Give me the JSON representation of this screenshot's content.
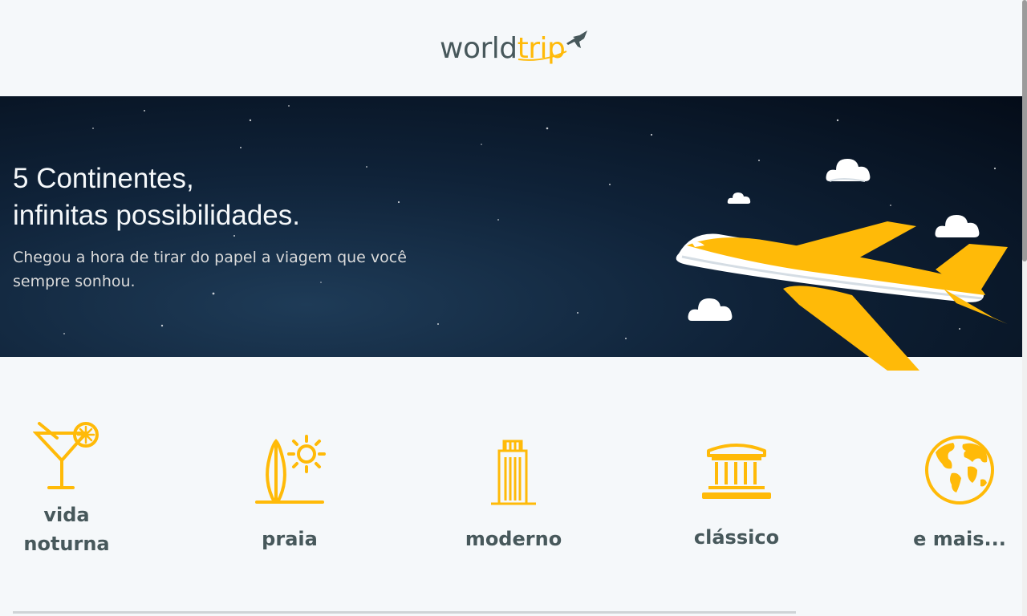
{
  "header": {
    "logo_main": "world",
    "logo_accent": "trip"
  },
  "banner": {
    "title": "5 Continentes,\ninfinitas possibilidades.",
    "subtitle": "Chegou a hora de tirar do papel a viagem que você sempre sonhou."
  },
  "travel_types": [
    {
      "label": "vida noturna",
      "icon": "cocktail-icon"
    },
    {
      "label": "praia",
      "icon": "surfboard-sun-icon"
    },
    {
      "label": "moderno",
      "icon": "building-icon"
    },
    {
      "label": "clássico",
      "icon": "museum-icon"
    },
    {
      "label": "e mais...",
      "icon": "globe-icon"
    }
  ],
  "colors": {
    "accent": "#ffba08",
    "text_dark": "#47585b",
    "background": "#f5f8fa"
  }
}
